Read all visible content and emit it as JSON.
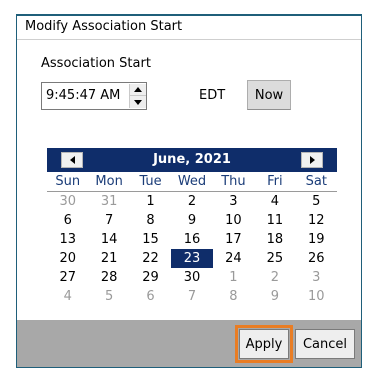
{
  "dialog": {
    "title": "Modify Association Start",
    "section_label": "Association Start",
    "time_value": "9:45:47 AM",
    "timezone": "EDT",
    "now_label": "Now",
    "apply_label": "Apply",
    "cancel_label": "Cancel"
  },
  "calendar": {
    "month_label": "June, 2021",
    "weekdays": [
      "Sun",
      "Mon",
      "Tue",
      "Wed",
      "Thu",
      "Fri",
      "Sat"
    ],
    "weeks": [
      [
        "30",
        "31",
        "1",
        "2",
        "3",
        "4",
        "5"
      ],
      [
        "6",
        "7",
        "8",
        "9",
        "10",
        "11",
        "12"
      ],
      [
        "13",
        "14",
        "15",
        "16",
        "17",
        "18",
        "19"
      ],
      [
        "20",
        "21",
        "22",
        "23",
        "24",
        "25",
        "26"
      ],
      [
        "27",
        "28",
        "29",
        "30",
        "1",
        "2",
        "3"
      ],
      [
        "4",
        "5",
        "6",
        "7",
        "8",
        "9",
        "10"
      ]
    ],
    "selected_day": "23",
    "current_month": "June"
  },
  "colors": {
    "header_navy": "#0f2d6a",
    "highlight_orange": "#e97d24",
    "footer_gray": "#a8a8a8"
  },
  "icons": {
    "prev": "triangle-left-icon",
    "next": "triangle-right-icon",
    "spin_up": "triangle-up-icon",
    "spin_down": "triangle-down-icon"
  }
}
